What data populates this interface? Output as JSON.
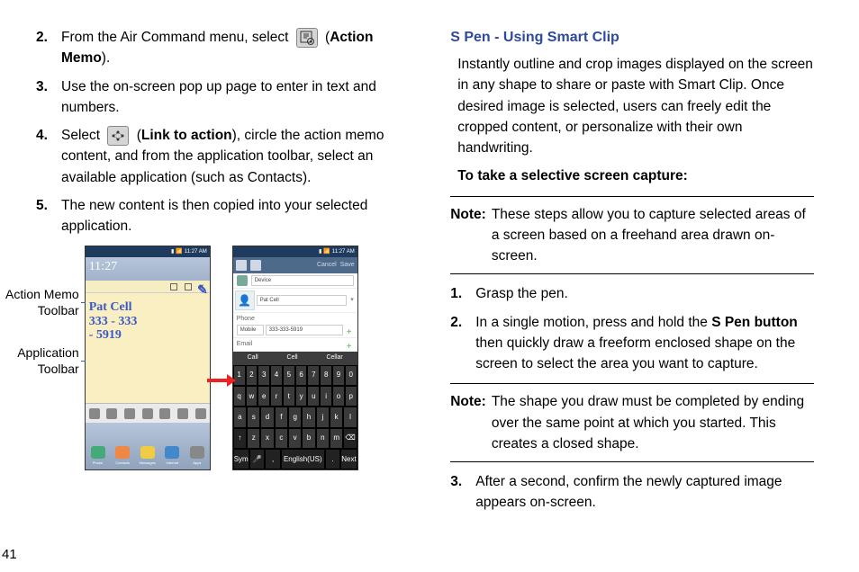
{
  "left": {
    "steps": [
      {
        "num": "2.",
        "text_a": "From the Air Command menu, select ",
        "text_b": " (",
        "bold": "Action Memo",
        "text_c": ")."
      },
      {
        "num": "3.",
        "text": "Use the on-screen pop up page to enter in text and numbers."
      },
      {
        "num": "4.",
        "text_a": "Select ",
        "text_b": " (",
        "bold": "Link to action",
        "text_c": "), circle the action memo content, and from the application toolbar, select an available application (such as Contacts)."
      },
      {
        "num": "5.",
        "text": "The new content is then copied into your selected application."
      }
    ],
    "fig_label_1a": "Action Memo",
    "fig_label_1b": "Toolbar",
    "fig_label_2a": "Application",
    "fig_label_2b": "Toolbar",
    "page_num": "41"
  },
  "right": {
    "heading": "S Pen - Using Smart Clip",
    "intro": "Instantly outline and crop images displayed on the screen in any shape to share or paste with Smart Clip. Once desired image is selected, users can freely edit the cropped content, or personalize with their own handwriting.",
    "subhead": "To take a selective screen capture:",
    "note1_label": "Note:",
    "note1_text": "These steps allow you to capture selected areas of a screen based on a freehand area drawn on-screen.",
    "step1_num": "1.",
    "step1_text": "Grasp the pen.",
    "step2_num": "2.",
    "step2_text_a": "In a single motion, press and hold the ",
    "step2_bold": "S Pen button",
    "step2_text_b": " then quickly draw a freeform enclosed shape on the screen to select the area you want to capture.",
    "note2_label": "Note:",
    "note2_text": "The shape you draw must be completed by ending over the same point at which you started. This creates a closed shape.",
    "step3_num": "3.",
    "step3_text": "After a second, confirm the newly captured image appears on-screen."
  },
  "phone1": {
    "time_status": "11:27 AM",
    "clock": "11:27",
    "memo_l1": "Pat Cell",
    "memo_l2": "333 - 333",
    "memo_l3": "- 5919",
    "dock": [
      "Phone",
      "Contacts",
      "Messages",
      "Internet",
      "Apps"
    ]
  },
  "phone2": {
    "time_status": "11:27 AM",
    "cancel": "Cancel",
    "save": "Save",
    "device_label": "Device",
    "name": "Pat Cell",
    "phone_label": "Phone",
    "phone_type": "Mobile",
    "phone_val": "333-333-5919",
    "email_label": "Email",
    "suggest": [
      "Call",
      "Cell",
      "Cellar"
    ],
    "kb_r1": [
      "1",
      "2",
      "3",
      "4",
      "5",
      "6",
      "7",
      "8",
      "9",
      "0"
    ],
    "kb_r2": [
      "q",
      "w",
      "e",
      "r",
      "t",
      "y",
      "u",
      "i",
      "o",
      "p"
    ],
    "kb_r3": [
      "a",
      "s",
      "d",
      "f",
      "g",
      "h",
      "j",
      "k",
      "l"
    ],
    "kb_r4": [
      "↑",
      "z",
      "x",
      "c",
      "v",
      "b",
      "n",
      "m",
      "⌫"
    ],
    "kb_r5": [
      "Sym",
      "🎤",
      ",",
      "English(US)",
      ".",
      "Next"
    ]
  }
}
